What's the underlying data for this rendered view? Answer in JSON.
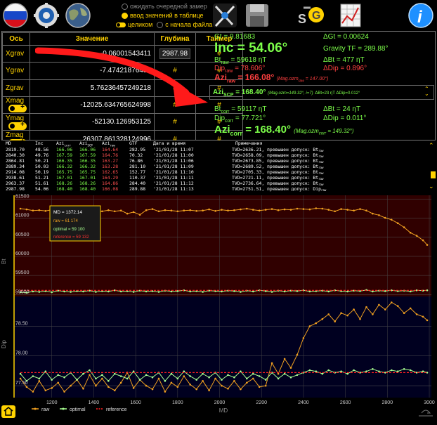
{
  "toolbar": {
    "radio_wait": "ожидать очередной замер",
    "radio_table": "ввод значений в таблице",
    "toggle_whole": "целиком",
    "radio_from_start": "с начала файла",
    "gs_label": "S G",
    "info_label": "i"
  },
  "axes_table": {
    "headers": [
      "Ось",
      "Значение",
      "Глубина",
      "Таймер"
    ],
    "rows": [
      {
        "axis": "Xgrav",
        "value": "-0.06001543411",
        "depth": "2987.98",
        "timer": "#"
      },
      {
        "axis": "Ygrav",
        "value": "-7.47421876450",
        "depth": "#",
        "timer": "#"
      },
      {
        "axis": "Zgrav",
        "value": "5.76236457249218",
        "depth": "#",
        "timer": "#"
      },
      {
        "axis": "Xmag",
        "value": "-12025.634765624998",
        "depth": "#",
        "timer": "#"
      },
      {
        "axis": "Ymag",
        "value": "-52130.126953125",
        "depth": "#",
        "timer": "#"
      },
      {
        "axis": "Zmag",
        "value": "26307.861328124996",
        "depth": "#",
        "timer": "#"
      }
    ]
  },
  "results": {
    "gt": "Gt = 9.81683",
    "dgt": "ΔGt = 0.00624",
    "inc": "Inc = 54.06°",
    "gravity_tf": "Gravity TF = 289.88°",
    "bt_raw_label": "Bt",
    "bt_raw_sub": "raw",
    "bt_raw_val": "= 59618 ηT",
    "dbt_raw": "ΔBt = 477 ηT",
    "dip_raw_label": "Dip",
    "dip_raw_sub": "raw",
    "dip_raw_val": "= 78.606°",
    "ddip_raw": "ΔDip = 0.896°",
    "azi_raw_label": "Azi",
    "azi_raw_sub": "raw",
    "azi_raw_val": "= 166.08°",
    "azi_raw_note": "(Mag.ozm",
    "azi_raw_note_sub": "raw",
    "azi_raw_note_end": "= 147.00°)",
    "azi_scp_label": "Azi",
    "azi_scp_sub": "SCP",
    "azi_scp_val": "= 168.40°",
    "azi_scp_note": "(Mag.ozm=149.32°, i=7)",
    "azi_scp_delta": "ΔBt=23 ηT   ΔDip=0.012°",
    "bt_corr_label": "Bt",
    "bt_corr_sub": "corr",
    "bt_corr_val": "= 59117 ηT",
    "dbt_corr": "ΔBt = 24 ηT",
    "dip_corr_label": "Dip",
    "dip_corr_sub": "corr",
    "dip_corr_val": "= 77.721°",
    "ddip_corr": "ΔDip = 0.011°",
    "azi_corr_label": "Azi",
    "azi_corr_sub": "corr",
    "azi_corr_val": "= 168.40°",
    "azi_corr_note": "(Mag.ozm",
    "azi_corr_note_sub": "corr",
    "azi_corr_note_end": "= 149.32°)"
  },
  "log": {
    "headers": [
      "MD",
      "Inc",
      "Azi",
      "Azi",
      "Azi",
      "GTF",
      "Дата и время",
      "Примечания"
    ],
    "header_subs": [
      "",
      "",
      "corr",
      "SCP",
      "raw",
      "",
      "",
      ""
    ],
    "rows": [
      [
        "2819.70",
        "48.56",
        "166.06",
        "166.06",
        "164.64",
        "282.95",
        "'21/01/28 11:07",
        "TVD=2636.21, превышен допуск: Bt"
      ],
      [
        "2840.30",
        "49.76",
        "167.59",
        "167.59",
        "164.76",
        "70.32",
        "'21/01/28 11:00",
        "TVD=2658.09, превышен допуск: Bt"
      ],
      [
        "2864.81",
        "50.21",
        "166.35",
        "166.35",
        "163.27",
        "76.86",
        "'21/01/28 11:06",
        "TVD=2673.85, превышен допуск: Bt"
      ],
      [
        "2889.34",
        "50.03",
        "166.32",
        "166.32",
        "163.28",
        "281.10",
        "'21/01/28 11:09",
        "TVD=2689.52, превышен допуск: Bt"
      ],
      [
        "2914.08",
        "50.19",
        "165.75",
        "165.75",
        "162.65",
        "152.77",
        "'21/01/28 11:10",
        "TVD=2705.33, превышен допуск: Bt"
      ],
      [
        "2938.61",
        "51.21",
        "167.01",
        "167.01",
        "164.29",
        "110.37",
        "'21/01/28 11:11",
        "TVD=2721.11, превышен допуск: Bt"
      ],
      [
        "2963.37",
        "51.61",
        "168.26",
        "168.26",
        "164.86",
        "284.40",
        "'21/01/28 11:12",
        "TVD=2736.64, превышен допуск: Bt"
      ],
      [
        "2987.98",
        "54.06",
        "168.40",
        "168.40",
        "166.08",
        "289.88",
        "'21/01/28 11:13",
        "TVD=2751.51, превышен допуск: Dip"
      ]
    ],
    "row_suffixes": [
      "raw",
      "raw",
      "raw",
      "raw",
      "raw",
      "raw",
      "raw",
      "raw"
    ]
  },
  "tooltip": {
    "md": "MD = 1372.14",
    "raw": "raw = 61 174",
    "optimal": "optimal = 59 100",
    "reference": "reference = 59 132"
  },
  "legend": {
    "raw": "raw",
    "optimal": "optimal",
    "reference": "reference"
  },
  "colors": {
    "raw": "#f0a020",
    "optimal": "#a8ff90",
    "reference": "#ff2020",
    "accent": "#ffd200"
  },
  "chart_data": [
    {
      "type": "line",
      "ylabel": "Bt",
      "xlabel": "",
      "xlim": [
        1020,
        3010
      ],
      "ylim": [
        58950,
        61600
      ],
      "y_ticks": [
        59000,
        59500,
        60000,
        60500,
        61000,
        61500
      ],
      "grid": true,
      "x": [
        1050,
        1080,
        1110,
        1140,
        1170,
        1200,
        1230,
        1260,
        1290,
        1320,
        1350,
        1380,
        1410,
        1440,
        1470,
        1500,
        1530,
        1560,
        1590,
        1620,
        1650,
        1680,
        1710,
        1740,
        1770,
        1800,
        1830,
        1860,
        1890,
        1920,
        1950,
        1980,
        2010,
        2040,
        2070,
        2100,
        2130,
        2160,
        2190,
        2220,
        2250,
        2280,
        2310,
        2340,
        2370,
        2400,
        2430,
        2460,
        2490,
        2520,
        2550,
        2580,
        2610,
        2640,
        2670,
        2700,
        2730,
        2760,
        2790,
        2820,
        2850,
        2880,
        2910,
        2940,
        2970,
        2990
      ],
      "series": [
        {
          "name": "raw",
          "values": [
            61250,
            61230,
            61200,
            61210,
            61190,
            61220,
            61240,
            61210,
            61200,
            61230,
            61180,
            61174,
            61150,
            61180,
            61210,
            61180,
            61200,
            61120,
            61160,
            61090,
            61210,
            61240,
            61180,
            61210,
            61200,
            61180,
            61200,
            61210,
            61190,
            61200,
            61230,
            61190,
            61220,
            61200,
            61210,
            61230,
            61250,
            61220,
            61200,
            61220,
            61240,
            61210,
            61230,
            61220,
            61250,
            61240,
            61230,
            61260,
            61250,
            61220,
            61180,
            61240,
            61220,
            61200,
            61240,
            61200,
            61120,
            61080,
            61010,
            60960,
            60870,
            60760,
            60620,
            60540,
            60420,
            60300
          ]
        },
        {
          "name": "optimal",
          "values": [
            59060,
            59050,
            59080,
            59070,
            59090,
            59060,
            59100,
            59080,
            59070,
            59090,
            59080,
            59100,
            59070,
            59090,
            59080,
            59110,
            59080,
            59090,
            59070,
            59100,
            59080,
            59090,
            59070,
            59100,
            59080,
            59090,
            59110,
            59080,
            59090,
            59070,
            59100,
            59090,
            59080,
            59100,
            59090,
            59070,
            59100,
            59080,
            59110,
            59090,
            59070,
            59100,
            59080,
            59100,
            59090,
            59110,
            59080,
            59090,
            59100,
            59080,
            59110,
            59090,
            59080,
            59100,
            59090,
            59120,
            59080,
            59100,
            59090,
            59110,
            59090,
            59100,
            59080,
            59110,
            59100,
            59110
          ]
        },
        {
          "name": "reference",
          "values": [
            59110,
            59110,
            59110,
            59110,
            59110,
            59110,
            59110,
            59110,
            59110,
            59110,
            59110,
            59110,
            59110,
            59110,
            59110,
            59110,
            59110,
            59110,
            59110,
            59110,
            59110,
            59110,
            59110,
            59110,
            59110,
            59110,
            59110,
            59110,
            59110,
            59110,
            59110,
            59110,
            59110,
            59110,
            59110,
            59110,
            59110,
            59110,
            59110,
            59110,
            59110,
            59110,
            59110,
            59110,
            59110,
            59110,
            59110,
            59110,
            59110,
            59110,
            59110,
            59110,
            59110,
            59110,
            59110,
            59110,
            59110,
            59110,
            59110,
            59110,
            59110,
            59110,
            59110,
            59110,
            59110,
            59110
          ]
        }
      ]
    },
    {
      "type": "line",
      "ylabel": "Dip",
      "xlabel": "MD",
      "xlim": [
        1020,
        3010
      ],
      "ylim": [
        77.3,
        79.0
      ],
      "y_ticks": [
        77.5,
        78.0,
        78.5
      ],
      "x_ticks": [
        1200,
        1400,
        1600,
        1800,
        2000,
        2200,
        2400,
        2600,
        2800,
        3000
      ],
      "grid": true,
      "x": [
        1050,
        1080,
        1110,
        1140,
        1170,
        1200,
        1230,
        1260,
        1290,
        1320,
        1350,
        1380,
        1410,
        1440,
        1470,
        1500,
        1530,
        1560,
        1590,
        1620,
        1650,
        1680,
        1710,
        1740,
        1770,
        1800,
        1830,
        1860,
        1890,
        1920,
        1950,
        1980,
        2010,
        2040,
        2070,
        2100,
        2130,
        2160,
        2190,
        2220,
        2250,
        2280,
        2310,
        2340,
        2370,
        2400,
        2430,
        2460,
        2490,
        2520,
        2550,
        2580,
        2610,
        2640,
        2670,
        2700,
        2730,
        2760,
        2790,
        2820,
        2850,
        2880,
        2910,
        2940,
        2970,
        2990
      ],
      "series": [
        {
          "name": "raw",
          "values": [
            77.62,
            77.48,
            77.4,
            77.58,
            77.42,
            77.46,
            77.55,
            77.4,
            77.5,
            77.6,
            77.45,
            77.68,
            77.5,
            77.62,
            77.48,
            77.42,
            77.55,
            77.72,
            77.46,
            77.6,
            77.5,
            77.44,
            77.62,
            77.4,
            77.55,
            77.48,
            77.66,
            77.52,
            77.44,
            77.58,
            77.42,
            77.62,
            77.5,
            77.45,
            77.58,
            77.44,
            77.55,
            77.62,
            77.48,
            77.5,
            77.88,
            77.7,
            77.95,
            77.8,
            78.02,
            78.3,
            78.5,
            78.55,
            78.62,
            78.7,
            78.58,
            78.72,
            78.68,
            78.78,
            78.62,
            78.82,
            78.7,
            78.86,
            78.78,
            78.9,
            78.84,
            78.72,
            78.8,
            78.7,
            78.66,
            78.6
          ]
        },
        {
          "name": "optimal",
          "values": [
            77.7,
            77.58,
            77.66,
            77.62,
            77.74,
            77.6,
            77.68,
            77.64,
            77.72,
            77.6,
            77.7,
            77.76,
            77.62,
            77.68,
            77.58,
            77.7,
            77.66,
            77.62,
            77.74,
            77.6,
            77.68,
            77.64,
            77.72,
            77.58,
            77.7,
            77.62,
            77.74,
            77.66,
            77.6,
            77.7,
            77.64,
            77.72,
            77.6,
            77.68,
            77.64,
            77.74,
            77.62,
            77.7,
            77.66,
            77.6,
            77.72,
            77.62,
            77.7,
            77.64,
            77.68,
            77.72,
            77.76,
            77.74,
            77.7,
            77.76,
            77.72,
            77.74,
            77.7,
            77.76,
            77.72,
            77.74,
            77.78,
            77.74,
            77.72,
            77.76,
            77.74,
            77.78,
            77.76,
            77.72,
            77.74,
            77.72
          ]
        },
        {
          "name": "reference",
          "values": [
            77.72,
            77.72,
            77.72,
            77.72,
            77.72,
            77.72,
            77.72,
            77.72,
            77.72,
            77.72,
            77.72,
            77.72,
            77.72,
            77.72,
            77.72,
            77.72,
            77.72,
            77.72,
            77.72,
            77.72,
            77.72,
            77.72,
            77.72,
            77.72,
            77.72,
            77.72,
            77.72,
            77.72,
            77.72,
            77.72,
            77.72,
            77.72,
            77.72,
            77.72,
            77.72,
            77.72,
            77.72,
            77.72,
            77.72,
            77.72,
            77.72,
            77.72,
            77.72,
            77.72,
            77.72,
            77.72,
            77.72,
            77.72,
            77.72,
            77.72,
            77.72,
            77.72,
            77.72,
            77.72,
            77.72,
            77.72,
            77.72,
            77.72,
            77.72,
            77.72,
            77.72,
            77.72,
            77.72,
            77.72,
            77.72,
            77.72
          ]
        }
      ]
    }
  ]
}
